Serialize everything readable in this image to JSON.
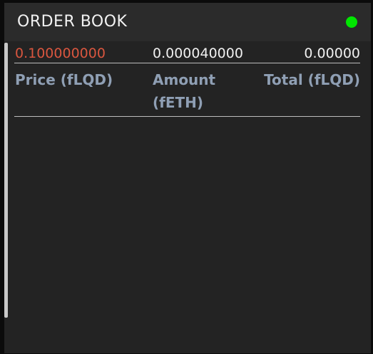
{
  "header": {
    "title": "ORDER BOOK",
    "status_color": "#00e600"
  },
  "order_book": {
    "columns": {
      "price": "Price (fLQD)",
      "amount": "Amount (fETH)",
      "total": "Total (fLQD)"
    },
    "rows": [
      {
        "price": "0.100000000",
        "amount": "0.000040000",
        "total": "0.00000",
        "side": "sell",
        "side_color": "#d9563f"
      }
    ]
  }
}
